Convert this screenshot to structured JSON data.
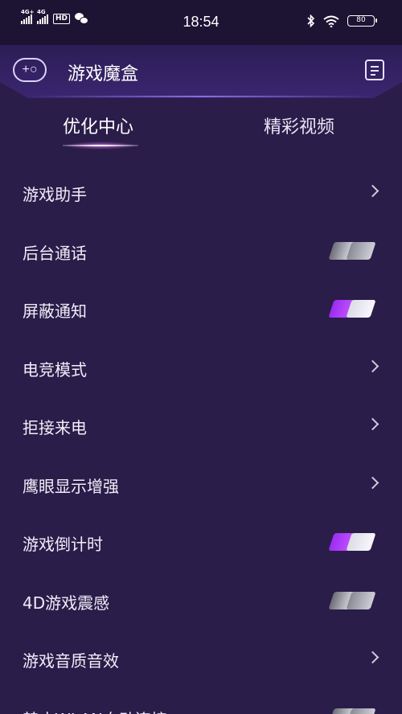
{
  "status_bar": {
    "signal_1": "4G+",
    "signal_2": "4G",
    "hd": "HD",
    "time": "18:54",
    "battery": "80"
  },
  "header": {
    "title": "游戏魔盒",
    "gamepad_icon_text": "+○"
  },
  "tabs": [
    {
      "label": "优化中心",
      "active": true
    },
    {
      "label": "精彩视频",
      "active": false
    }
  ],
  "items": [
    {
      "label": "游戏助手",
      "control": "chevron"
    },
    {
      "label": "后台通话",
      "control": "toggle",
      "state": "off"
    },
    {
      "label": "屏蔽通知",
      "control": "toggle",
      "state": "on"
    },
    {
      "label": "电竞模式",
      "control": "chevron"
    },
    {
      "label": "拒接来电",
      "control": "chevron"
    },
    {
      "label": "鹰眼显示增强",
      "control": "chevron"
    },
    {
      "label": "游戏倒计时",
      "control": "toggle",
      "state": "on"
    },
    {
      "label": "4D游戏震感",
      "control": "toggle",
      "state": "off"
    },
    {
      "label": "游戏音质音效",
      "control": "chevron"
    },
    {
      "label": "禁止WLAN自动连接",
      "control": "toggle",
      "state": "off"
    }
  ],
  "colors": {
    "background": "#2a1d49",
    "accent_purple": "#a63af5"
  }
}
